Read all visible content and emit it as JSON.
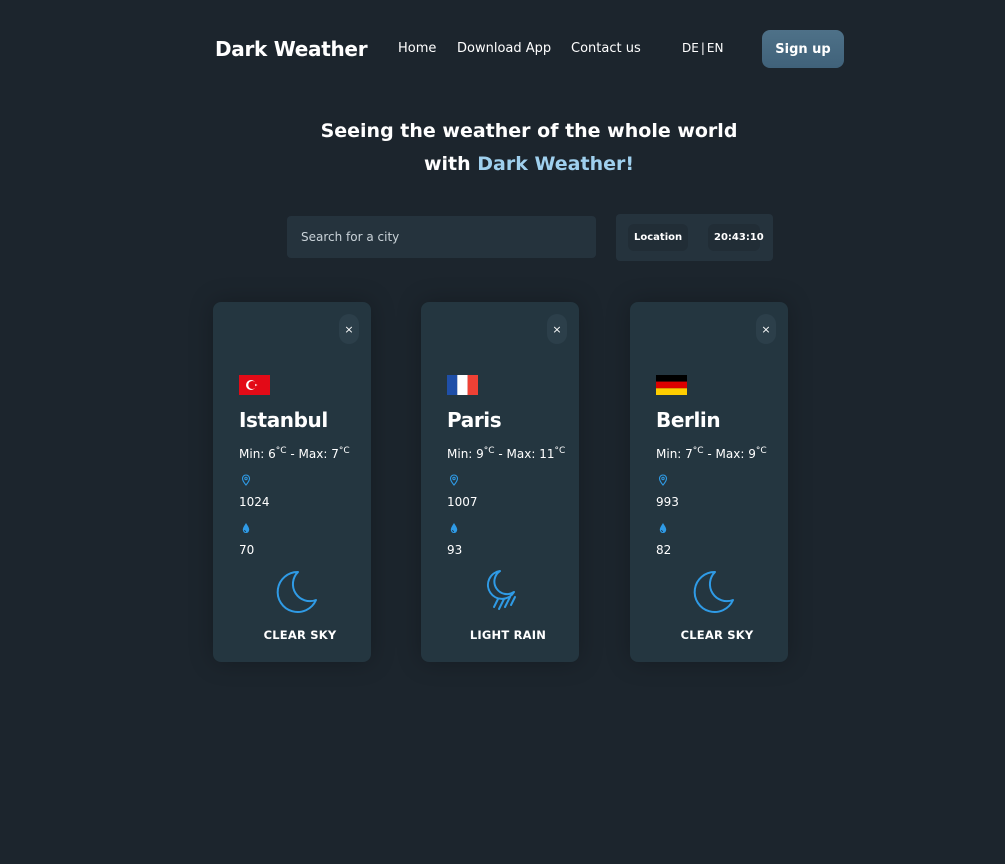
{
  "header": {
    "brand": "Dark Weather",
    "nav": {
      "home": "Home",
      "download": "Download App",
      "contact": "Contact us"
    },
    "lang": {
      "de": "DE",
      "sep": "|",
      "en": "EN"
    },
    "signup": "Sign up"
  },
  "hero": {
    "line1": "Seeing the weather of the whole world",
    "line2_prefix": "with ",
    "line2_accent": "Dark Weather!"
  },
  "search": {
    "placeholder": "Search for a city",
    "value": ""
  },
  "tools": {
    "location": "Location",
    "clock": "20:43:10"
  },
  "colors": {
    "background": "#1c252d",
    "card": "#243640",
    "accent": "#9fd0ee",
    "icon_blue": "#2f9be6",
    "signup": "#4a6b82"
  },
  "cards": [
    {
      "close": "×",
      "flag_icon": "turkey-flag-icon",
      "city": "Istanbul",
      "min_label": "Min: ",
      "min": "6",
      "max_label": " - Max: ",
      "max": "7",
      "unit": "°C",
      "pressure_icon": "map-pin-icon",
      "pressure": "1024",
      "humidity_icon": "water-drop-icon",
      "humidity": "70",
      "weather_icon": "moon-icon",
      "description": "CLEAR SKY"
    },
    {
      "close": "×",
      "flag_icon": "france-flag-icon",
      "city": "Paris",
      "min_label": "Min: ",
      "min": "9",
      "max_label": " - Max: ",
      "max": "11",
      "unit": "°C",
      "pressure_icon": "map-pin-icon",
      "pressure": "1007",
      "humidity_icon": "water-drop-icon",
      "humidity": "93",
      "weather_icon": "moon-rain-icon",
      "description": "LIGHT RAIN"
    },
    {
      "close": "×",
      "flag_icon": "germany-flag-icon",
      "city": "Berlin",
      "min_label": "Min: ",
      "min": "7",
      "max_label": " - Max: ",
      "max": "9",
      "unit": "°C",
      "pressure_icon": "map-pin-icon",
      "pressure": "993",
      "humidity_icon": "water-drop-icon",
      "humidity": "82",
      "weather_icon": "moon-icon",
      "description": "CLEAR SKY"
    }
  ]
}
